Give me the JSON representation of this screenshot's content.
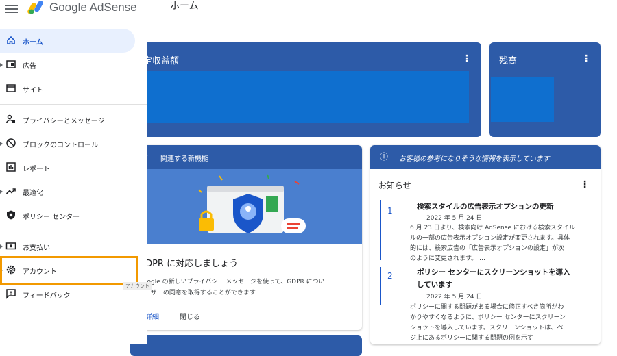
{
  "header": {
    "brand": "Google AdSense",
    "page_title": "ホーム"
  },
  "sidebar": {
    "items": [
      {
        "label": "ホーム",
        "icon": "home-icon",
        "active": true
      },
      {
        "label": "広告",
        "icon": "ad-icon"
      },
      {
        "label": "サイト",
        "icon": "site-icon"
      },
      {
        "label": "プライバシーとメッセージ",
        "icon": "privacy-icon"
      },
      {
        "label": "ブロックのコントロール",
        "icon": "block-icon"
      },
      {
        "label": "レポート",
        "icon": "report-icon"
      },
      {
        "label": "最適化",
        "icon": "optimize-icon"
      },
      {
        "label": "ポリシー センター",
        "icon": "policy-icon"
      },
      {
        "label": "お支払い",
        "icon": "payment-icon"
      },
      {
        "label": "アカウント",
        "icon": "gear-icon"
      },
      {
        "label": "フィードバック",
        "icon": "feedback-icon"
      }
    ],
    "tooltip": "アカウント"
  },
  "cards": {
    "estimated_earnings": {
      "title": "推定収益額"
    },
    "balance": {
      "title": "残高"
    },
    "features": {
      "header": "関連する新機能",
      "headline": "GDPR に対応しましょう",
      "body_line1": "Google の新しいプライバシー メッセージを使って、GDPR につい",
      "body_line2": "ユーザーの同意を取得することができます",
      "details": "詳細",
      "close": "閉じる"
    },
    "info": {
      "header": "お客様の参考になりそうな情報を表示しています",
      "title": "お知らせ",
      "news": [
        {
          "num": "1",
          "title": "検索スタイルの広告表示オプションの更新",
          "date": "2022 年 5 月 24 日",
          "lines": [
            "6 月 23 日より、検索向け AdSense における検索スタイル",
            "ルの一部の広告表示オプション設定が変更されます。具体",
            "的には、検索広告の「広告表示オプションの設定」が次",
            "のように変更されます。 …"
          ]
        },
        {
          "num": "2",
          "title_line1": "ポリシー センターにスクリーンショットを導入",
          "title_line2": "しています",
          "date": "2022 年 5 月 24 日",
          "lines": [
            "ポリシーに関する問題がある場合に修正すべき箇所がわ",
            "かりやすくなるように、ポリシー センターにスクリーン",
            "ショットを導入しています。スクリーンショットは、ペー",
            "ジ上にあるポリシーに関する問題の例を示す"
          ]
        }
      ]
    }
  },
  "colors": {
    "card_dark": "#2d5ba8",
    "inner_blue": "#0f6fcf",
    "highlight": "#f29900",
    "active_bg": "#e8f0fe"
  }
}
